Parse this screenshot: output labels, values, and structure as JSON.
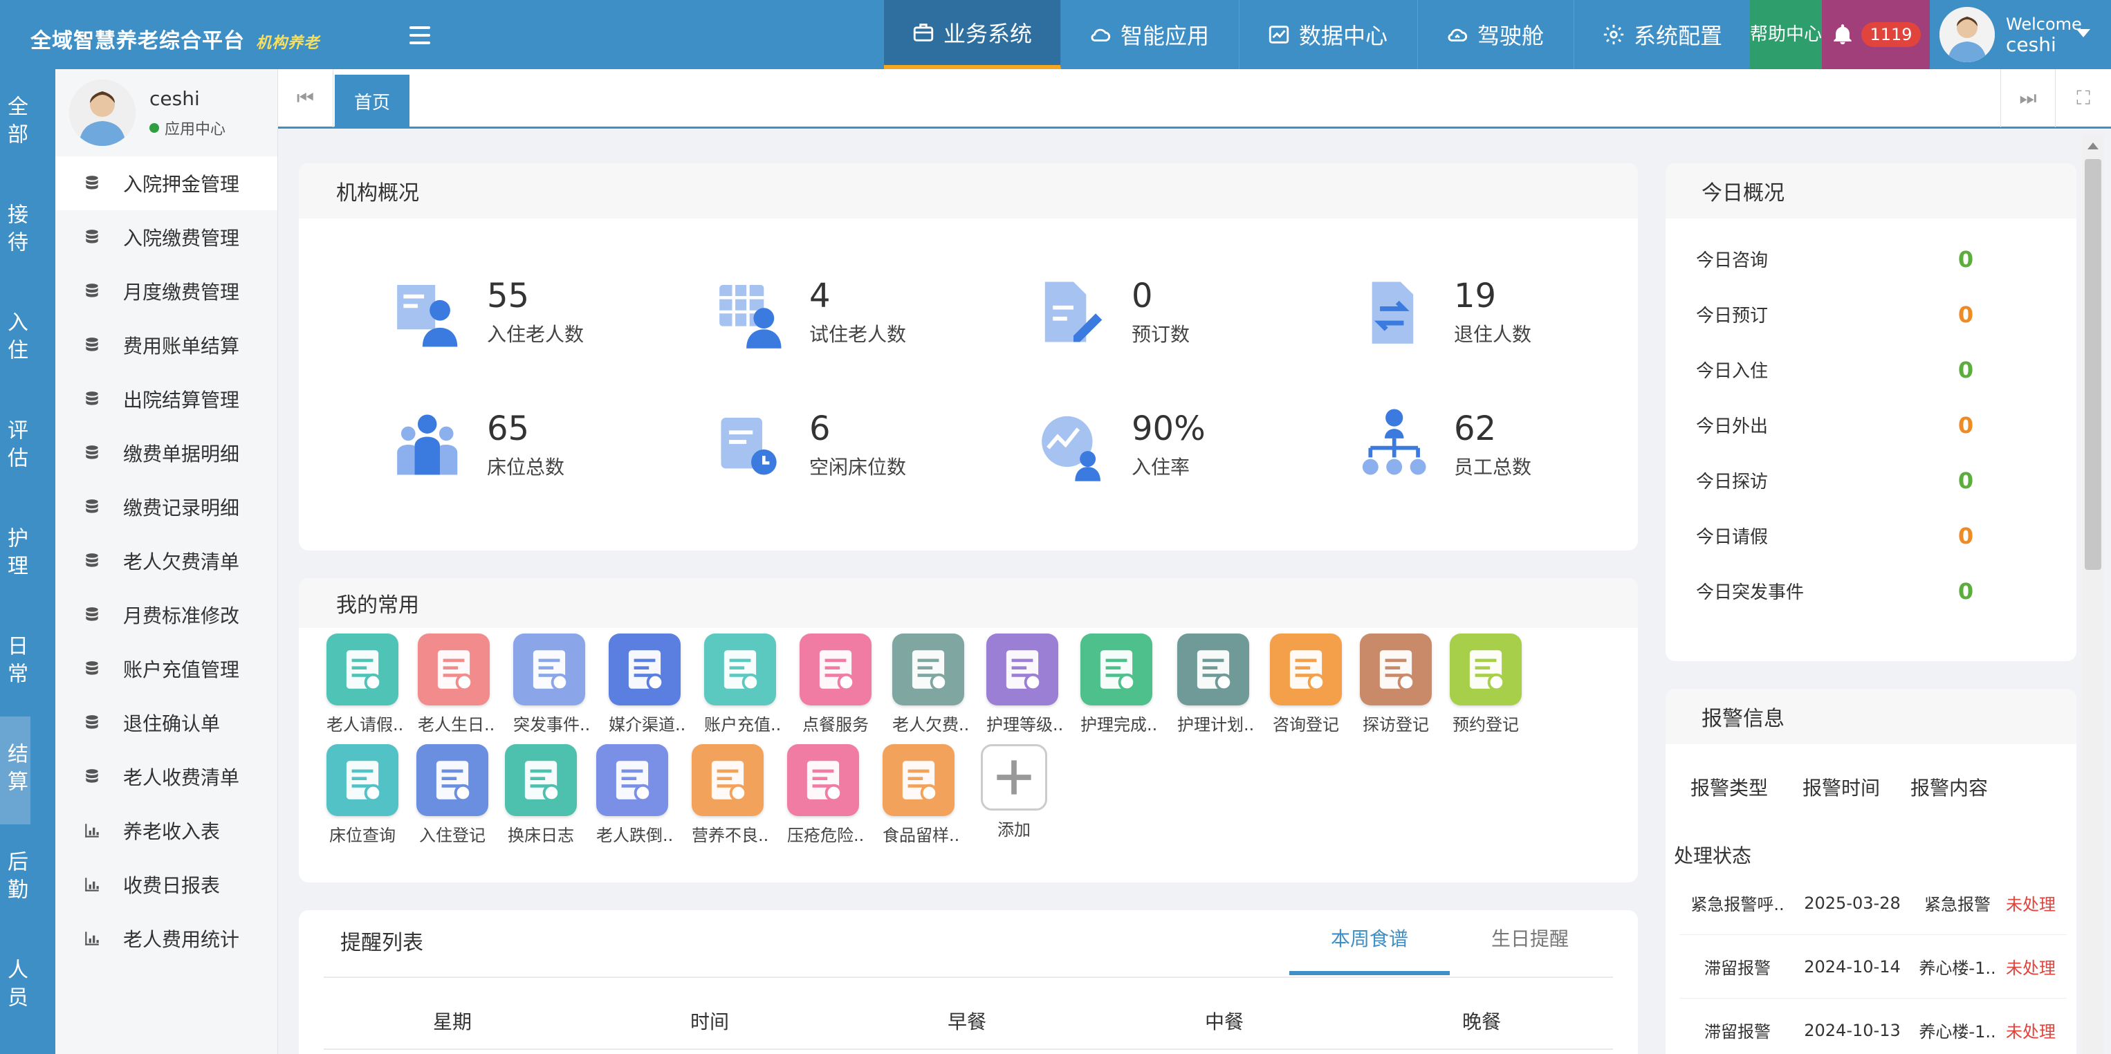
{
  "app": {
    "title": "全域智慧养老综合平台",
    "subtitle": "机构养老"
  },
  "topnav": [
    {
      "label": "业务系统",
      "icon": "briefcase-icon"
    },
    {
      "label": "智能应用",
      "icon": "cloud-icon"
    },
    {
      "label": "数据中心",
      "icon": "chart-icon"
    },
    {
      "label": "驾驶舱",
      "icon": "cloud-dashboard-icon"
    },
    {
      "label": "系统配置",
      "icon": "gear-icon"
    }
  ],
  "help": {
    "label": "帮助中心"
  },
  "notifications": {
    "count": "1119"
  },
  "user": {
    "welcome": "Welcome",
    "name": "ceshi"
  },
  "rail": [
    "全部",
    "接待",
    "入住",
    "评估",
    "护理",
    "日常",
    "结算",
    "后勤",
    "人员"
  ],
  "profile": {
    "name": "ceshi",
    "status": "应用中心"
  },
  "menu": [
    "入院押金管理",
    "入院缴费管理",
    "月度缴费管理",
    "费用账单结算",
    "出院结算管理",
    "缴费单据明细",
    "缴费记录明细",
    "老人欠费清单",
    "月费标准修改",
    "账户充值管理",
    "退住确认单",
    "老人收费清单",
    "养老收入表",
    "收费日报表",
    "老人费用统计"
  ],
  "tabs": {
    "home": "首页"
  },
  "overview": {
    "title": "机构概况",
    "stats": [
      {
        "value": "55",
        "label": "入住老人数"
      },
      {
        "value": "4",
        "label": "试住老人数"
      },
      {
        "value": "0",
        "label": "预订数"
      },
      {
        "value": "19",
        "label": "退住人数"
      },
      {
        "value": "65",
        "label": "床位总数"
      },
      {
        "value": "6",
        "label": "空闲床位数"
      },
      {
        "value": "90%",
        "label": "入住率"
      },
      {
        "value": "62",
        "label": "员工总数"
      }
    ]
  },
  "favorites": {
    "title": "我的常用",
    "apps": [
      {
        "label": "老人请假..",
        "color": "#4fc3b6"
      },
      {
        "label": "老人生日..",
        "color": "#f28b8b"
      },
      {
        "label": "突发事件..",
        "color": "#8aa6e8"
      },
      {
        "label": "媒介渠道..",
        "color": "#5b7fe0"
      },
      {
        "label": "账户充值..",
        "color": "#5cc9c0"
      },
      {
        "label": "点餐服务",
        "color": "#f07ba3"
      },
      {
        "label": "老人欠费..",
        "color": "#7fa6a0"
      },
      {
        "label": "护理等级..",
        "color": "#9b7fd4"
      },
      {
        "label": "护理完成..",
        "color": "#4ec08b"
      },
      {
        "label": "护理计划..",
        "color": "#6f9a98"
      },
      {
        "label": "咨询登记",
        "color": "#f4a04a"
      },
      {
        "label": "探访登记",
        "color": "#c98a6a"
      },
      {
        "label": "预约登记",
        "color": "#a7cf4a"
      },
      {
        "label": "床位查询",
        "color": "#52c2c7"
      },
      {
        "label": "入住登记",
        "color": "#6b8fe0"
      },
      {
        "label": "换床日志",
        "color": "#4ec0ae"
      },
      {
        "label": "老人跌倒..",
        "color": "#7a8fe6"
      },
      {
        "label": "营养不良..",
        "color": "#f3a25c"
      },
      {
        "label": "压疮危险..",
        "color": "#f07ba3"
      },
      {
        "label": "食品留样..",
        "color": "#f3a25c"
      },
      {
        "label": "添加",
        "color": "#ffffff"
      }
    ]
  },
  "reminders": {
    "title": "提醒列表",
    "tabs": [
      "本周食谱",
      "生日提醒"
    ],
    "columns": [
      "星期",
      "时间",
      "早餐",
      "中餐",
      "晚餐"
    ]
  },
  "today": {
    "title": "今日概况",
    "rows": [
      {
        "label": "今日咨询",
        "value": "0",
        "color": "#5cae3a"
      },
      {
        "label": "今日预订",
        "value": "0",
        "color": "#f08a24"
      },
      {
        "label": "今日入住",
        "value": "0",
        "color": "#5cae3a"
      },
      {
        "label": "今日外出",
        "value": "0",
        "color": "#f08a24"
      },
      {
        "label": "今日探访",
        "value": "0",
        "color": "#5cae3a"
      },
      {
        "label": "今日请假",
        "value": "0",
        "color": "#f08a24"
      },
      {
        "label": "今日突发事件",
        "value": "0",
        "color": "#5cae3a"
      }
    ]
  },
  "alarms": {
    "title": "报警信息",
    "columns": [
      "报警类型",
      "报警时间",
      "报警内容",
      "处理状态"
    ],
    "rows": [
      {
        "type": "紧急报警呼..",
        "time": "2025-03-28",
        "content": "紧急报警",
        "status": "未处理"
      },
      {
        "type": "滞留报警",
        "time": "2024-10-14",
        "content": "养心楼-1..",
        "status": "未处理"
      },
      {
        "type": "滞留报警",
        "time": "2024-10-13",
        "content": "养心楼-1..",
        "status": "未处理"
      }
    ]
  }
}
